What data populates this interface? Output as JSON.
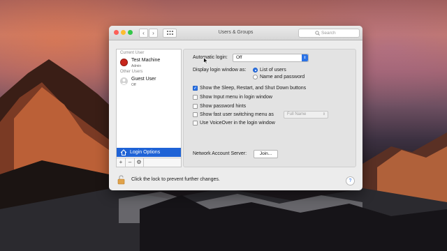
{
  "window": {
    "title": "Users & Groups",
    "nav_back": "‹",
    "nav_forward": "›",
    "grid_icon": "grid-icon",
    "search_placeholder": "Search"
  },
  "sidebar": {
    "current_user_label": "Current User",
    "other_users_label": "Other Users",
    "users": [
      {
        "name": "Test Machine",
        "role": "Admin",
        "avatar_color": "#c8261c"
      },
      {
        "name": "Guest User",
        "role": "Off",
        "avatar_color": "#d3d3d3"
      }
    ],
    "login_options_label": "Login Options",
    "add_label": "+",
    "remove_label": "–",
    "action_label": "⚙"
  },
  "pane": {
    "automatic_login_label": "Automatic login:",
    "automatic_login_value": "Off",
    "display_login_as_label": "Display login window as:",
    "radio_options": [
      {
        "label": "List of users",
        "selected": true
      },
      {
        "label": "Name and password",
        "selected": false
      }
    ],
    "checkboxes": [
      {
        "label": "Show the Sleep, Restart, and Shut Down buttons",
        "checked": true
      },
      {
        "label": "Show Input menu in login window",
        "checked": false
      },
      {
        "label": "Show password hints",
        "checked": false
      },
      {
        "label": "Show fast user switching menu as",
        "checked": false
      },
      {
        "label": "Use VoiceOver in the login window",
        "checked": false
      }
    ],
    "fast_user_switching_value": "Full Name",
    "network_account_server_label": "Network Account Server:",
    "join_label": "Join..."
  },
  "footer": {
    "lock_text": "Click the lock to prevent further changes.",
    "help_label": "?"
  },
  "colors": {
    "accent": "#2a72e6",
    "selection": "#1f63d6",
    "lock": "#e0a24a"
  }
}
